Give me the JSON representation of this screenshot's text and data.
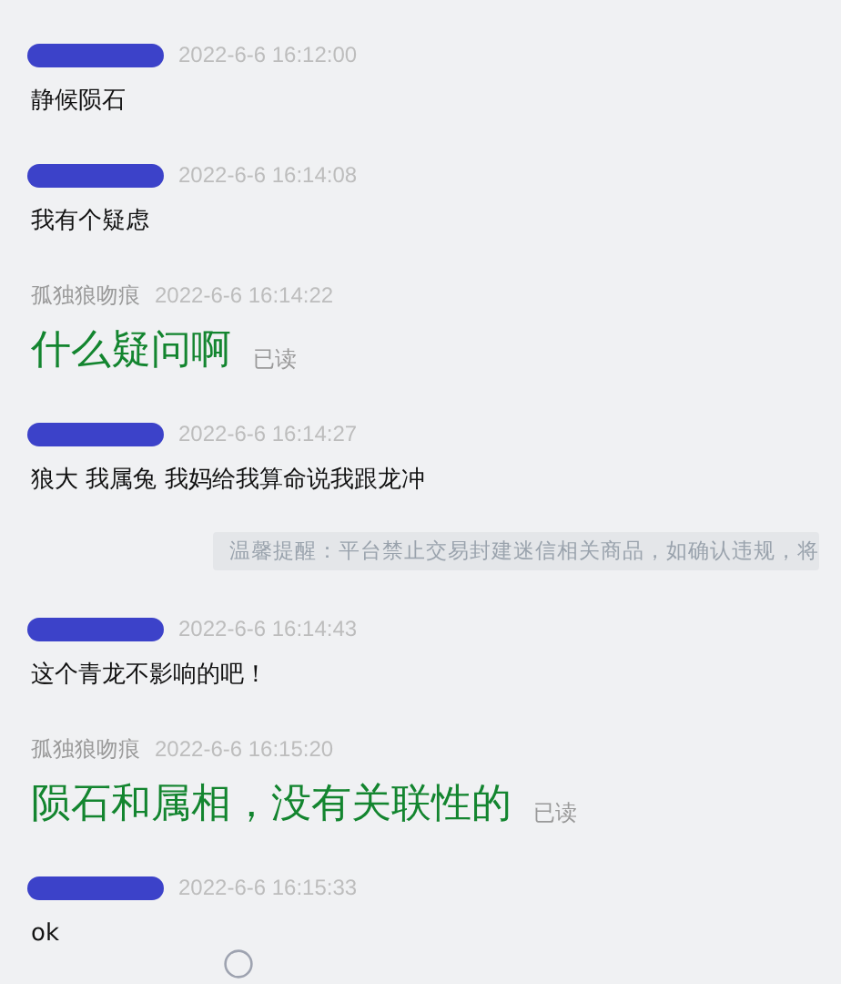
{
  "items": [
    {
      "kind": "message",
      "sender_hidden": true,
      "time": "2022-6-6 16:12:00",
      "text": "静候陨石",
      "outgoing": false
    },
    {
      "kind": "message",
      "sender_hidden": true,
      "time": "2022-6-6 16:14:08",
      "text": "我有个疑虑",
      "outgoing": false
    },
    {
      "kind": "message",
      "sender_hidden": false,
      "sender": "孤独狼吻痕",
      "time": "2022-6-6 16:14:22",
      "text": "什么疑问啊",
      "outgoing": true,
      "read_status": "已读"
    },
    {
      "kind": "message",
      "sender_hidden": true,
      "time": "2022-6-6 16:14:27",
      "text": "狼大 我属兔 我妈给我算命说我跟龙冲",
      "outgoing": false
    },
    {
      "kind": "notice",
      "text": "温馨提醒：平台禁止交易封建迷信相关商品，如确认违规，将"
    },
    {
      "kind": "message",
      "sender_hidden": true,
      "time": "2022-6-6 16:14:43",
      "text": "这个青龙不影响的吧！",
      "outgoing": false
    },
    {
      "kind": "message",
      "sender_hidden": false,
      "sender": "孤独狼吻痕",
      "time": "2022-6-6 16:15:20",
      "text": "陨石和属相，没有关联性的",
      "outgoing": true,
      "read_status": "已读"
    },
    {
      "kind": "message",
      "sender_hidden": true,
      "time": "2022-6-6 16:15:33",
      "text": "ok",
      "outgoing": false
    }
  ]
}
